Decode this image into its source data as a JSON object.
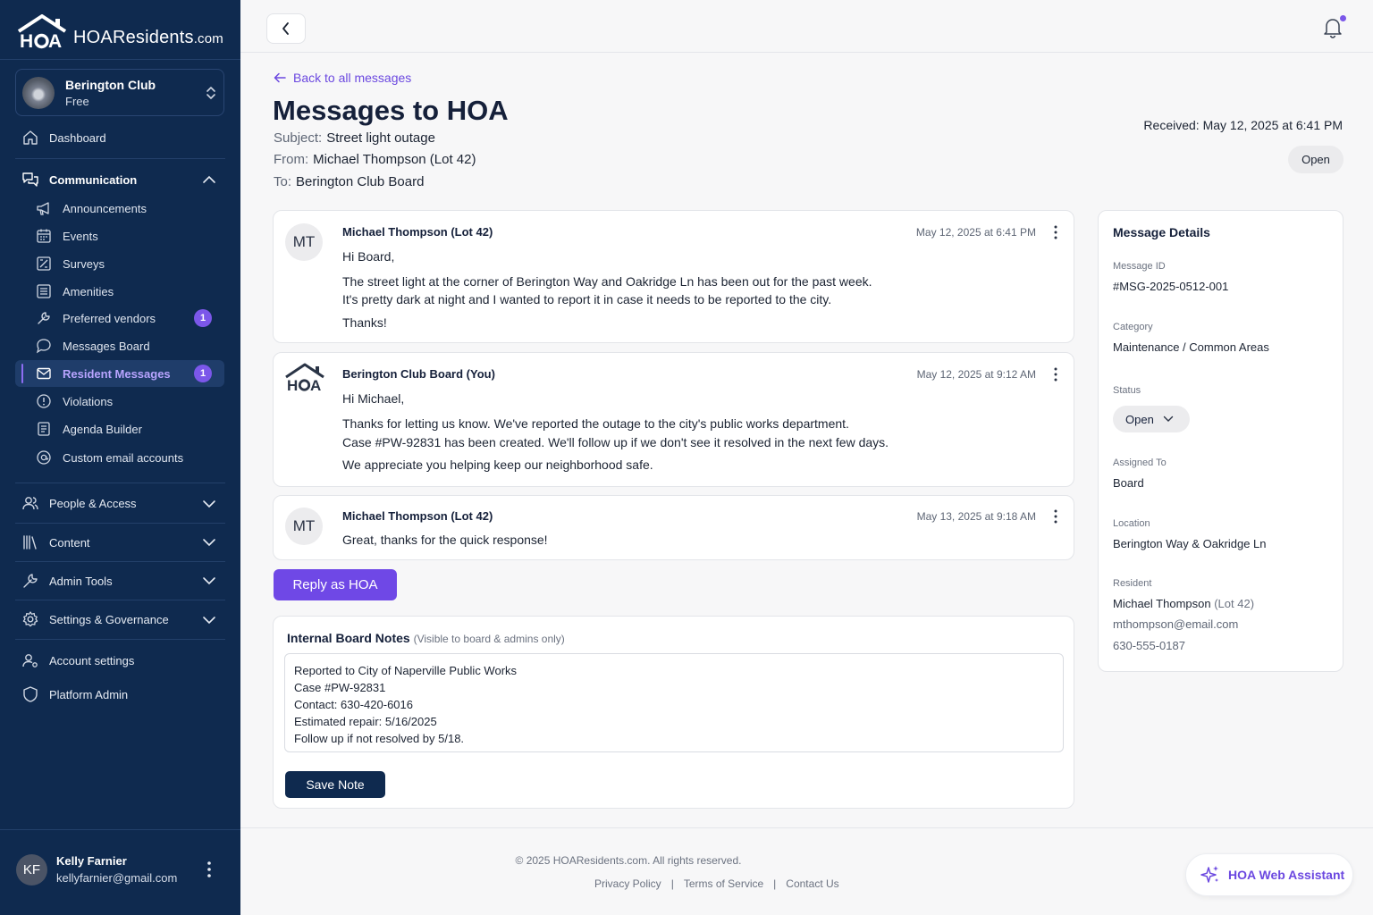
{
  "brand": {
    "name": "HOAResidents",
    "domain": ".com",
    "accent": "#6f48e6",
    "sidebar_bg": "#0f2a4f"
  },
  "club": {
    "name": "Berington Club",
    "plan": "Free"
  },
  "nav": {
    "dashboard": "Dashboard",
    "communication": "Communication",
    "sub_items": [
      {
        "label": "Announcements",
        "icon": "megaphone-icon"
      },
      {
        "label": "Events",
        "icon": "calendar-icon"
      },
      {
        "label": "Surveys",
        "icon": "survey-icon"
      },
      {
        "label": "Amenities",
        "icon": "amenities-icon"
      },
      {
        "label": "Preferred vendors",
        "icon": "wrench-icon",
        "badge": "1"
      },
      {
        "label": "Messages Board",
        "icon": "chat-bubble-icon"
      },
      {
        "label": "Resident Messages",
        "icon": "mail-icon",
        "badge": "1",
        "active": true
      },
      {
        "label": "Violations",
        "icon": "alert-circle-icon"
      },
      {
        "label": "Agenda Builder",
        "icon": "agenda-icon"
      },
      {
        "label": "Custom email accounts",
        "icon": "at-sign-icon"
      }
    ],
    "people_access": "People & Access",
    "content": "Content",
    "admin_tools": "Admin Tools",
    "settings_governance": "Settings & Governance",
    "account_settings": "Account settings",
    "platform_admin": "Platform Admin"
  },
  "user": {
    "initials": "KF",
    "name": "Kelly Farnier",
    "email": "kellyfarnier@gmail.com"
  },
  "header": {
    "back_link": "Back to all messages",
    "title": "Messages to HOA",
    "subject_label": "Subject:",
    "subject": "Street light outage",
    "from_label": "From:",
    "from": "Michael Thompson (Lot 42)",
    "to_label": "To:",
    "to": "Berington Club Board",
    "received": "Received: May 12, 2025 at 6:41 PM",
    "status": "Open"
  },
  "messages": [
    {
      "initials": "MT",
      "author": "Michael Thompson (Lot 42)",
      "time": "May 12, 2025 at 6:41 PM",
      "lines": [
        "Hi Board,",
        "The street light at the corner of Berington Way and Oakridge Ln has been out for the past week.",
        "It's pretty dark at night and I wanted to report it in case it needs to be reported to the city.",
        "Thanks!"
      ]
    },
    {
      "initials": "HOA",
      "author": "Berington Club Board (You)",
      "time": "May 12, 2025 at 9:12 AM",
      "lines": [
        "Hi Michael,",
        "Thanks for letting us know. We've reported the outage to the city's public works department.",
        "Case #PW-92831 has been created. We'll follow up if we don't see it resolved in the next few days.",
        "We appreciate you helping keep our neighborhood safe."
      ]
    },
    {
      "initials": "MT",
      "author": "Michael Thompson (Lot 42)",
      "time": "May 13, 2025 at 9:18 AM",
      "lines": [
        "Great, thanks for the quick response!"
      ]
    }
  ],
  "reply_button": "Reply as HOA",
  "notes": {
    "title": "Internal Board Notes",
    "subtitle": "(Visible to board & admins only)",
    "lines": [
      "Reported to City of Naperville Public Works",
      "Case #PW-92831",
      "Contact: 630-420-6016",
      "Estimated repair: 5/16/2025",
      "Follow up if not resolved by 5/18."
    ],
    "save_button": "Save Note"
  },
  "details": {
    "title": "Message Details",
    "message_id_label": "Message ID",
    "message_id": "#MSG-2025-0512-001",
    "category_label": "Category",
    "category": "Maintenance / Common Areas",
    "status_label": "Status",
    "status": "Open",
    "assigned_label": "Assigned To",
    "assigned": "Board",
    "location_label": "Location",
    "location": "Berington Way & Oakridge Ln",
    "resident_label": "Resident",
    "resident_name": "Michael Thompson",
    "resident_lot": "(Lot 42)",
    "resident_email": "mthompson@email.com",
    "resident_phone": "630-555-0187"
  },
  "footer": {
    "copyright": "© 2025 HOAResidents.com. All rights reserved.",
    "privacy": "Privacy Policy",
    "terms": "Terms of Service",
    "contact": "Contact Us",
    "separator": "|"
  },
  "assistant": {
    "label": "HOA Web Assistant"
  }
}
